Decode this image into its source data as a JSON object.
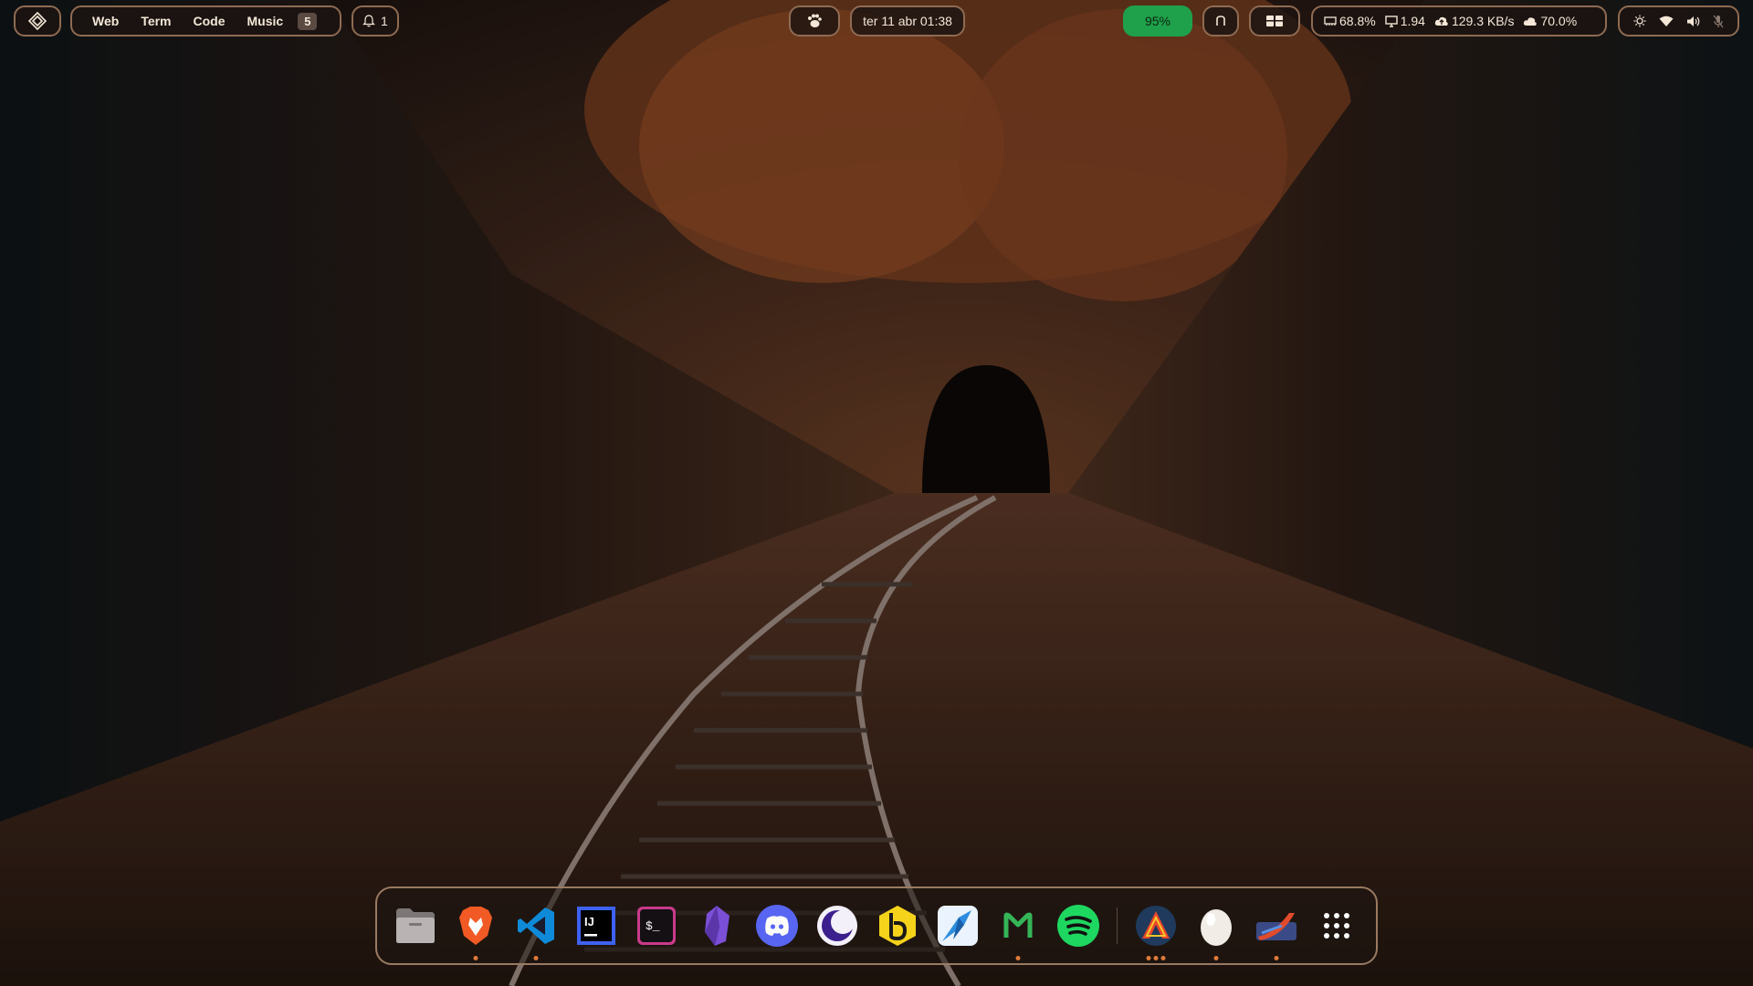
{
  "topbar": {
    "launcher_icon": "diamond-logo-icon",
    "workspaces": [
      "Web",
      "Term",
      "Code",
      "Music"
    ],
    "workspace_count_badge": "5",
    "notifications": {
      "icon": "bell-icon",
      "count": "1"
    },
    "center_icon": "paw-icon",
    "clock": "ter 11 abr 01:38",
    "battery": {
      "value": "95%",
      "color": "#1ea14a"
    },
    "layout_icon_a": "arch-hat-icon",
    "layout_icon_b": "layout-icon",
    "stats": {
      "memory": {
        "icon": "memory-icon",
        "value": "68.8%"
      },
      "load": {
        "icon": "monitor-icon",
        "value": "1.94"
      },
      "network": {
        "icon": "cloud-upload-icon",
        "value": "129.3 KB/s"
      },
      "weather": {
        "icon": "cloud-icon",
        "value": "70.0%"
      }
    },
    "tray_icons": [
      "brightness-icon",
      "wifi-icon",
      "volume-icon",
      "microphone-off-icon"
    ]
  },
  "dock": {
    "apps": [
      {
        "name": "Files",
        "icon": "folder-icon"
      },
      {
        "name": "Brave",
        "icon": "brave-lion-icon",
        "running": 1
      },
      {
        "name": "Visual Studio Code",
        "icon": "vscode-icon",
        "running": 1
      },
      {
        "name": "IntelliJ IDEA",
        "icon": "intellij-icon"
      },
      {
        "name": "Terminal",
        "icon": "terminal-icon"
      },
      {
        "name": "Obsidian",
        "icon": "obsidian-icon"
      },
      {
        "name": "Discord",
        "icon": "discord-icon"
      },
      {
        "name": "Moon",
        "icon": "moon-icon"
      },
      {
        "name": "Beekeeper",
        "icon": "beekeeper-icon"
      },
      {
        "name": "Studio",
        "icon": "studio-icon"
      },
      {
        "name": "Mongo",
        "icon": "mongo-m-icon",
        "running": 1
      },
      {
        "name": "Spotify",
        "icon": "spotify-icon"
      },
      {
        "name": "Aggregator",
        "icon": "triangle-a-icon",
        "running": 3
      },
      {
        "name": "Egg",
        "icon": "egg-icon",
        "running": 1
      },
      {
        "name": "Shell",
        "icon": "swoosh-icon",
        "running": 1
      },
      {
        "name": "App Grid",
        "icon": "app-grid-icon"
      }
    ]
  },
  "colors": {
    "accent": "#8f6b52",
    "running_dot": "#e07a3a"
  }
}
